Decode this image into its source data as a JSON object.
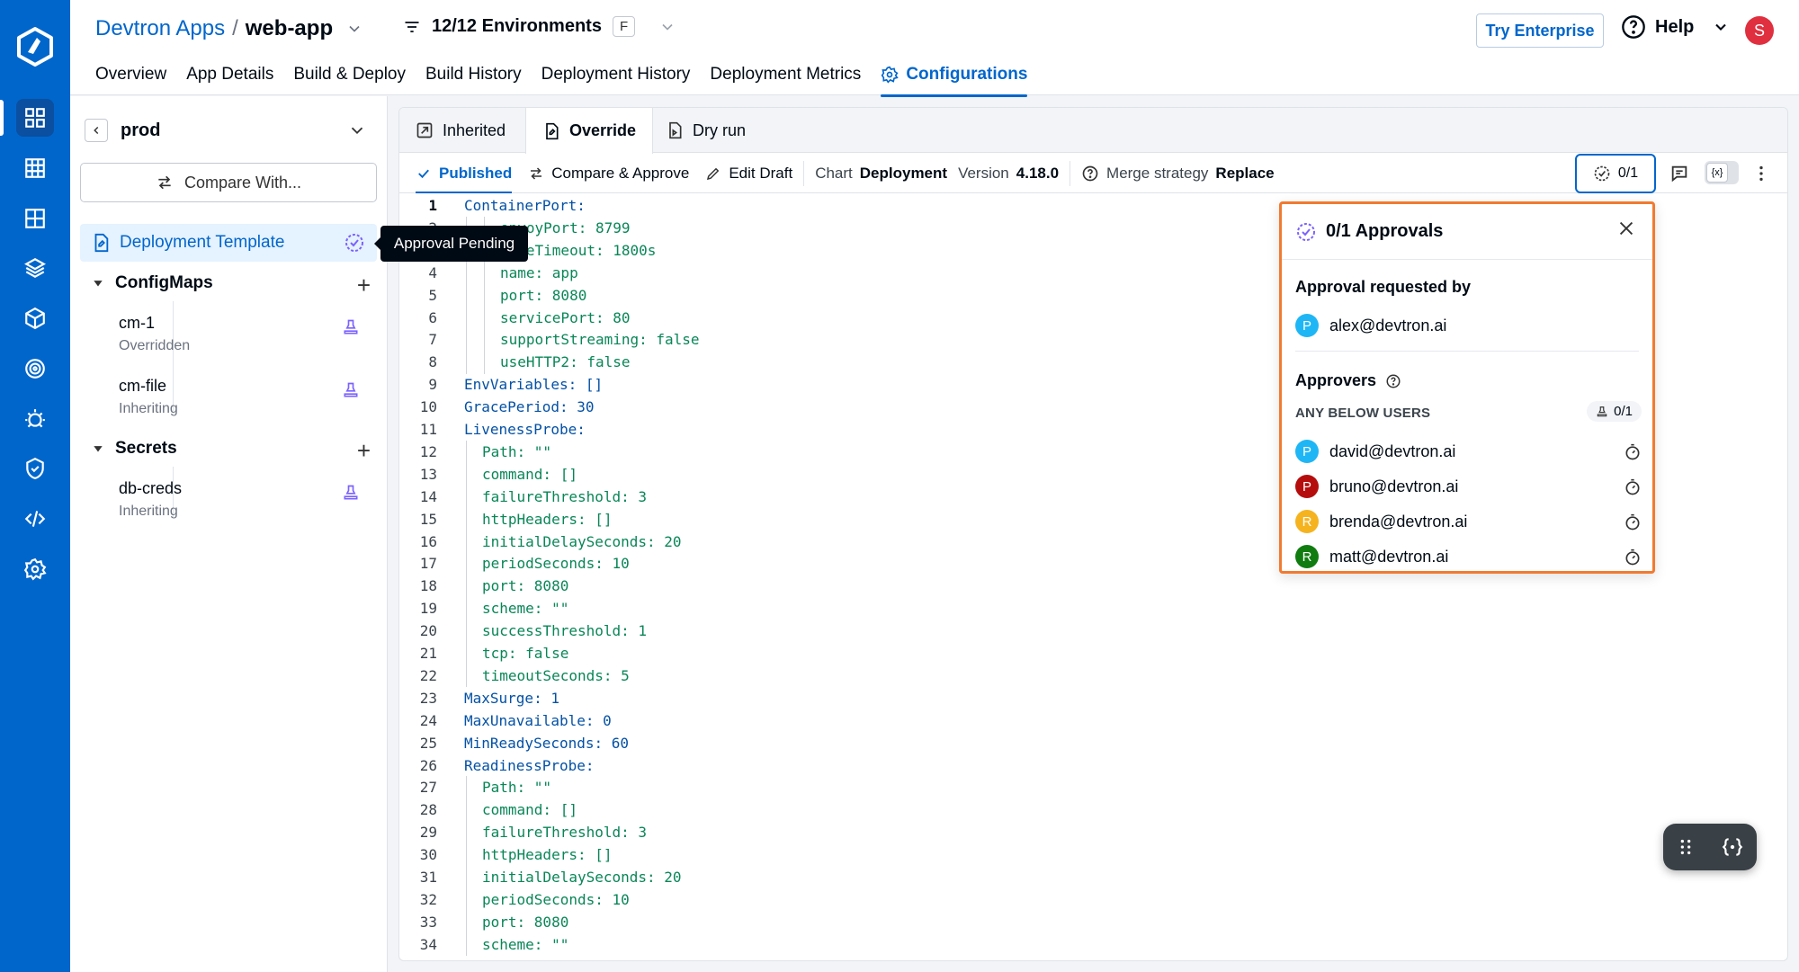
{
  "header": {
    "org_link": "Devtron Apps",
    "separator": "/",
    "app_name": "web-app",
    "environments": "12/12 Environments",
    "env_badge": "F",
    "try_enterprise": "Try Enterprise",
    "help": "Help",
    "user_initial": "S",
    "tabs": [
      {
        "label": "Overview"
      },
      {
        "label": "App Details"
      },
      {
        "label": "Build & Deploy"
      },
      {
        "label": "Build History"
      },
      {
        "label": "Deployment History"
      },
      {
        "label": "Deployment Metrics"
      },
      {
        "label": "Configurations"
      }
    ]
  },
  "sidebar": {
    "environment": "prod",
    "compare_label": "Compare With...",
    "selected_item": "Deployment Template",
    "tooltip": "Approval Pending",
    "configmaps_label": "ConfigMaps",
    "configmaps": [
      {
        "name": "cm-1",
        "status": "Overridden"
      },
      {
        "name": "cm-file",
        "status": "Inheriting"
      }
    ],
    "secrets_label": "Secrets",
    "secrets": [
      {
        "name": "db-creds",
        "status": "Inheriting"
      }
    ]
  },
  "editor": {
    "tabs": [
      {
        "label": "Inherited"
      },
      {
        "label": "Override"
      },
      {
        "label": "Dry run"
      }
    ],
    "toolbar": {
      "published": "Published",
      "compare_approve": "Compare & Approve",
      "edit_draft": "Edit Draft",
      "chart_label": "Chart",
      "chart_value": "Deployment",
      "version_label": "Version",
      "version_value": "4.18.0",
      "merge_label": "Merge strategy",
      "merge_value": "Replace",
      "approval_count": "0/1"
    },
    "lines": [
      {
        "n": "1",
        "t": "ContainerPort:"
      },
      {
        "n": "2",
        "t": "envoyPort: 8799"
      },
      {
        "n": "3",
        "t": "idleTimeout: 1800s"
      },
      {
        "n": "4",
        "t": "name: app"
      },
      {
        "n": "5",
        "t": "port: 8080"
      },
      {
        "n": "6",
        "t": "servicePort: 80"
      },
      {
        "n": "7",
        "t": "supportStreaming: false"
      },
      {
        "n": "8",
        "t": "useHTTP2: false"
      },
      {
        "n": "9",
        "t": "EnvVariables: []"
      },
      {
        "n": "10",
        "t": "GracePeriod: 30"
      },
      {
        "n": "11",
        "t": "LivenessProbe:"
      },
      {
        "n": "12",
        "t": "Path: \"\""
      },
      {
        "n": "13",
        "t": "command: []"
      },
      {
        "n": "14",
        "t": "failureThreshold: 3"
      },
      {
        "n": "15",
        "t": "httpHeaders: []"
      },
      {
        "n": "16",
        "t": "initialDelaySeconds: 20"
      },
      {
        "n": "17",
        "t": "periodSeconds: 10"
      },
      {
        "n": "18",
        "t": "port: 8080"
      },
      {
        "n": "19",
        "t": "scheme: \"\""
      },
      {
        "n": "20",
        "t": "successThreshold: 1"
      },
      {
        "n": "21",
        "t": "tcp: false"
      },
      {
        "n": "22",
        "t": "timeoutSeconds: 5"
      },
      {
        "n": "23",
        "t": "MaxSurge: 1"
      },
      {
        "n": "24",
        "t": "MaxUnavailable: 0"
      },
      {
        "n": "25",
        "t": "MinReadySeconds: 60"
      },
      {
        "n": "26",
        "t": "ReadinessProbe:"
      },
      {
        "n": "27",
        "t": "Path: \"\""
      },
      {
        "n": "28",
        "t": "command: []"
      },
      {
        "n": "29",
        "t": "failureThreshold: 3"
      },
      {
        "n": "30",
        "t": "httpHeaders: []"
      },
      {
        "n": "31",
        "t": "initialDelaySeconds: 20"
      },
      {
        "n": "32",
        "t": "periodSeconds: 10"
      },
      {
        "n": "33",
        "t": "port: 8080"
      },
      {
        "n": "34",
        "t": "scheme: \"\""
      }
    ]
  },
  "approvals": {
    "title": "0/1 Approvals",
    "requested_by_label": "Approval requested by",
    "requester": {
      "initial": "P",
      "email": "alex@devtron.ai",
      "color": "#1fb6f5"
    },
    "approvers_label": "Approvers",
    "any_below": "ANY BELOW USERS",
    "count": "0/1",
    "approvers": [
      {
        "initial": "P",
        "email": "david@devtron.ai",
        "color": "#1fb6f5"
      },
      {
        "initial": "P",
        "email": "bruno@devtron.ai",
        "color": "#b50d0d"
      },
      {
        "initial": "R",
        "email": "brenda@devtron.ai",
        "color": "#f5b31f"
      },
      {
        "initial": "R",
        "email": "matt@devtron.ai",
        "color": "#107c10"
      }
    ]
  },
  "colors": {
    "brand": "#0066cc",
    "popover_border": "#f27a30"
  }
}
